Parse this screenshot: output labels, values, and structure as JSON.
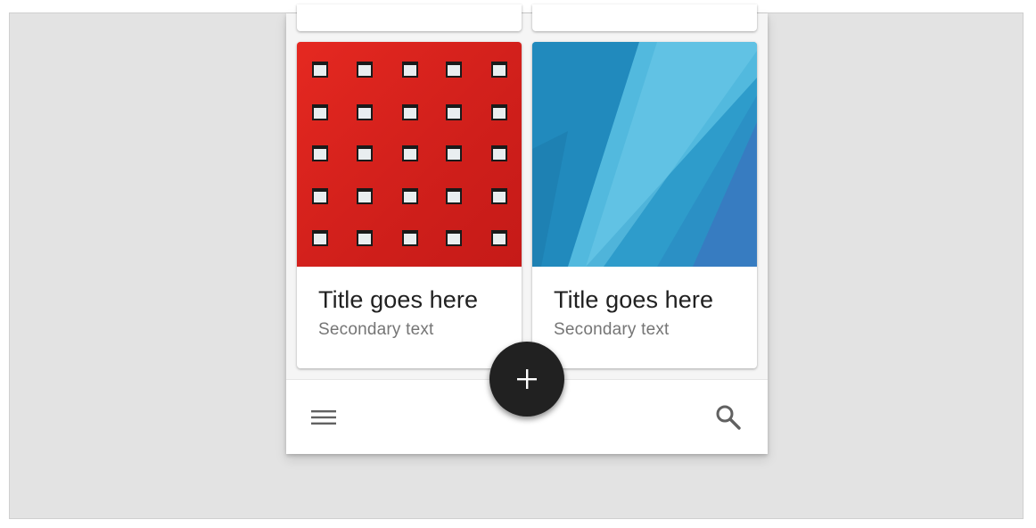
{
  "cards": [
    {
      "title": "Title goes here",
      "secondary": "Secondary text",
      "image": "red-building-windows-photo"
    },
    {
      "title": "Title goes here",
      "secondary": "Secondary text",
      "image": "blue-abstract-photo"
    }
  ],
  "bottom_bar": {
    "menu_icon": "menu-icon",
    "search_icon": "search-icon"
  },
  "fab": {
    "icon": "add-icon"
  },
  "colors": {
    "background": "#e3e3e3",
    "surface": "#ffffff",
    "fab": "#212121",
    "title_text": "#212121",
    "secondary_text": "#757575",
    "icon": "#616161"
  }
}
